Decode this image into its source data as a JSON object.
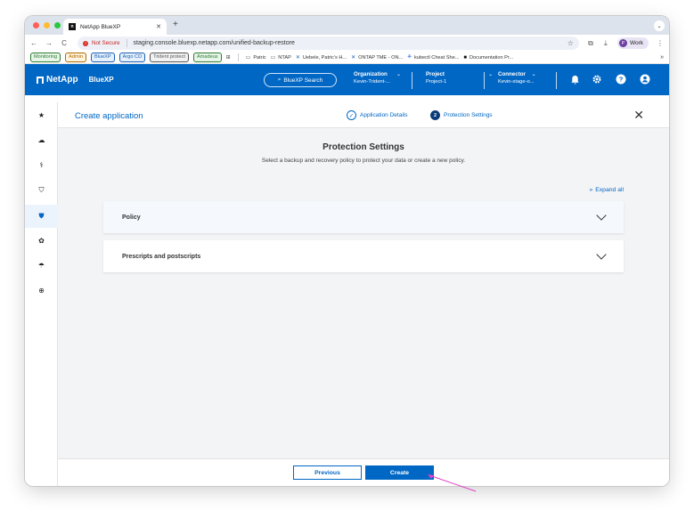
{
  "browser": {
    "tab_title": "NetApp BlueXP",
    "not_secure": "Not Secure",
    "url": "staging.console.bluexp.netapp.com/unified-backup-restore",
    "profile": "Work",
    "profile_initial": "P",
    "bookmarks_chips": [
      {
        "label": "Monitoring",
        "color": "#2e7d32",
        "bg": "#e8f5e9"
      },
      {
        "label": "Admin",
        "color": "#b26a00",
        "bg": "#fff4e0"
      },
      {
        "label": "BlueXP",
        "color": "#1a5fb4",
        "bg": "#e6f0fb"
      },
      {
        "label": "Argo CD",
        "color": "#1a5fb4",
        "bg": "#e6f0fb"
      },
      {
        "label": "Trident protect",
        "color": "#555555",
        "bg": "#f2f2f2"
      },
      {
        "label": "Amadeus",
        "color": "#2e7d32",
        "bg": "#e8f5e9"
      }
    ],
    "bookmarks": [
      {
        "icon": "folder-icon",
        "glyph": "▭",
        "label": "Patric"
      },
      {
        "icon": "folder-icon",
        "glyph": "▭",
        "label": "NTAP"
      },
      {
        "icon": "confluence-icon",
        "glyph": "✕",
        "label": "Uebele, Patric's H..."
      },
      {
        "icon": "confluence-icon",
        "glyph": "✕",
        "label": "ONTAP TME - ON..."
      },
      {
        "icon": "kubernetes-icon",
        "glyph": "⎈",
        "label": "kubectl Cheat She..."
      },
      {
        "icon": "netapp-icon",
        "glyph": "■",
        "label": "Documentation Pr..."
      }
    ]
  },
  "header": {
    "logo": "NetApp",
    "product": "BlueXP",
    "search_label": "BlueXP Search",
    "organization_key": "Organization",
    "organization_value": "Kevin-Trident-...",
    "project_key": "Project",
    "project_value": "Project-1",
    "connector_key": "Connector",
    "connector_value": "Kevin-stage-o..."
  },
  "wizard": {
    "title": "Create application",
    "step1": "Application Details",
    "step2": "Protection Settings",
    "step2_num": "2",
    "heading": "Protection Settings",
    "subtext": "Select a backup and recovery policy to protect your data or create a new policy.",
    "expand_all": "Expand all",
    "panel_policy": "Policy",
    "panel_prescripts": "Prescripts and postscripts",
    "btn_previous": "Previous",
    "btn_create": "Create"
  },
  "colors": {
    "brand_blue": "#0067c5",
    "step_dark": "#0b3c7a",
    "annotation": "#e040c8"
  }
}
